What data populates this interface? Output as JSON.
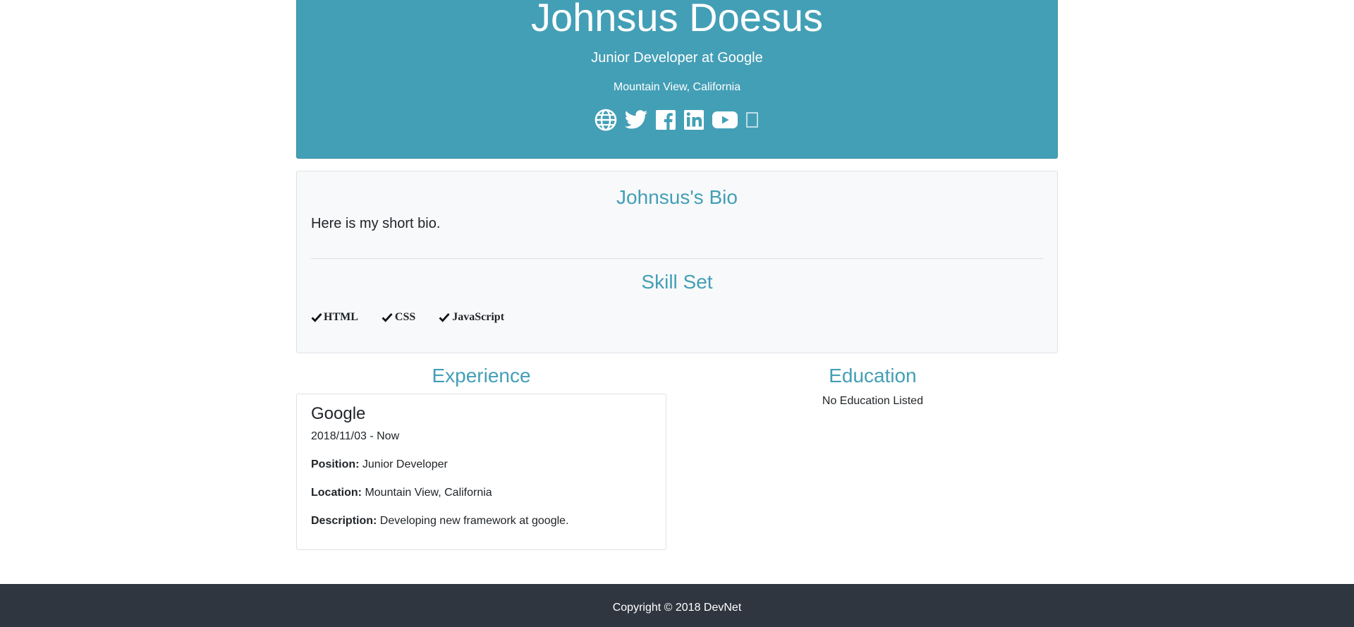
{
  "profile": {
    "name": "Johnsus Doesus",
    "status": "Junior Developer at Google",
    "location": "Mountain View, California",
    "accent_color": "#439fb6",
    "social_icons": [
      "globe-icon",
      "twitter-icon",
      "facebook-icon",
      "linkedin-icon",
      "youtube-icon",
      "instagram-icon"
    ]
  },
  "bio": {
    "title": "Johnsus's Bio",
    "text": "Here is my short bio.",
    "skills_title": "Skill Set",
    "skills": [
      "HTML",
      "CSS",
      "JavaScript"
    ]
  },
  "experience": {
    "title": "Experience",
    "items": [
      {
        "company": "Google",
        "dates": "2018/11/03 - Now",
        "position_label": "Position:",
        "position": "Junior Developer",
        "location_label": "Location:",
        "location": "Mountain View, California",
        "description_label": "Description:",
        "description": "Developing new framework at google."
      }
    ]
  },
  "education": {
    "title": "Education",
    "empty_text": "No Education Listed"
  },
  "footer": {
    "text": "Copyright © 2018 DevNet",
    "background": "#2f3640"
  }
}
